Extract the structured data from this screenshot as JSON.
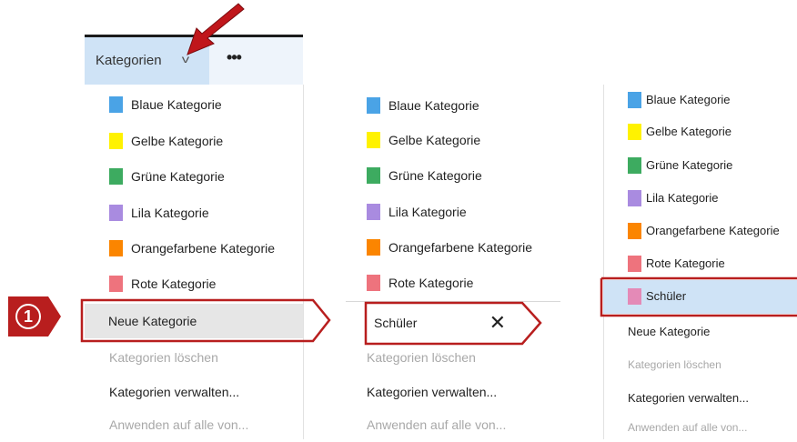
{
  "toolbar": {
    "categories_label": "Kategorien",
    "chevron_glyph": "v",
    "more_glyph": "•••"
  },
  "callout": {
    "number": "1"
  },
  "colors": {
    "blue": "#4aa3e6",
    "yellow": "#fff200",
    "green": "#3dab60",
    "purple": "#a98be0",
    "orange": "#fb8500",
    "red": "#ee737d",
    "pink": "#e48ab7",
    "highlight_red": "#b81e1e"
  },
  "panel1": {
    "items": [
      {
        "label": "Blaue Kategorie",
        "color": "#4aa3e6"
      },
      {
        "label": "Gelbe Kategorie",
        "color": "#fff200"
      },
      {
        "label": "Grüne Kategorie",
        "color": "#3dab60"
      },
      {
        "label": "Lila Kategorie",
        "color": "#a98be0"
      },
      {
        "label": "Orangefarbene Kategorie",
        "color": "#fb8500"
      },
      {
        "label": "Rote Kategorie",
        "color": "#ee737d"
      }
    ],
    "new_category": "Neue Kategorie",
    "delete_categories": "Kategorien löschen",
    "manage_categories": "Kategorien verwalten...",
    "apply_to_all": "Anwenden auf alle von..."
  },
  "panel2": {
    "items": [
      {
        "label": "Blaue Kategorie",
        "color": "#4aa3e6"
      },
      {
        "label": "Gelbe Kategorie",
        "color": "#fff200"
      },
      {
        "label": "Grüne Kategorie",
        "color": "#3dab60"
      },
      {
        "label": "Lila Kategorie",
        "color": "#a98be0"
      },
      {
        "label": "Orangefarbene Kategorie",
        "color": "#fb8500"
      },
      {
        "label": "Rote Kategorie",
        "color": "#ee737d"
      }
    ],
    "input_value": "Schüler",
    "clear_glyph": "✕",
    "delete_categories": "Kategorien löschen",
    "manage_categories": "Kategorien verwalten...",
    "apply_to_all": "Anwenden auf alle von..."
  },
  "panel3": {
    "items": [
      {
        "label": "Blaue Kategorie",
        "color": "#4aa3e6"
      },
      {
        "label": "Gelbe Kategorie",
        "color": "#fff200"
      },
      {
        "label": "Grüne Kategorie",
        "color": "#3dab60"
      },
      {
        "label": "Lila Kategorie",
        "color": "#a98be0"
      },
      {
        "label": "Orangefarbene Kategorie",
        "color": "#fb8500"
      },
      {
        "label": "Rote Kategorie",
        "color": "#ee737d"
      },
      {
        "label": "Schüler",
        "color": "#e48ab7"
      }
    ],
    "new_category": "Neue Kategorie",
    "delete_categories": "Kategorien löschen",
    "manage_categories": "Kategorien verwalten...",
    "apply_to_all": "Anwenden auf alle von..."
  }
}
